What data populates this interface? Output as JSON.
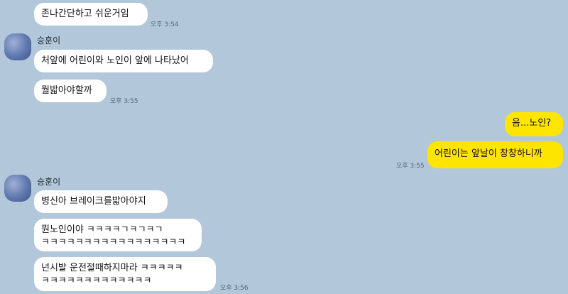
{
  "messages": {
    "m1": {
      "text": "존나간단하고 쉬운거임",
      "time": "오후 3:54"
    },
    "sender1": {
      "name": "승훈이"
    },
    "m2": {
      "text": "처앞에 어린이와 노인이 앞에 나타났어"
    },
    "m3": {
      "text": "뭘밟아야할까",
      "time": "오후 3:55"
    },
    "m4": {
      "text": "음...노인?"
    },
    "m5": {
      "text": "어린이는 앞날이 창창하니까",
      "time": "오후 3:55"
    },
    "sender2": {
      "name": "승훈이"
    },
    "m6": {
      "text": "병신아 브레이크를밟아야지"
    },
    "m7": {
      "line1": "뭔노인이야 ㅋㅋㅋㅋㄱㅋㄱㅋㄱ",
      "line2": "ㅋㅋㅋㅋㅋㅋㅋㅋㅋㅋㅋㅋㅋㅋㅋㅋㅋ"
    },
    "m8": {
      "line1": "넌시발 운전절때하지마라 ㅋㅋㅋㅋㅋ",
      "line2": "ㅋㅋㅋㅋㅋㅋㅋㅋㅋㅋㅋㅋㅋ",
      "time": "오후 3:56"
    }
  },
  "colors": {
    "background": "#b2c7d9",
    "bubble_other": "#ffffff",
    "bubble_me": "#fee500"
  }
}
